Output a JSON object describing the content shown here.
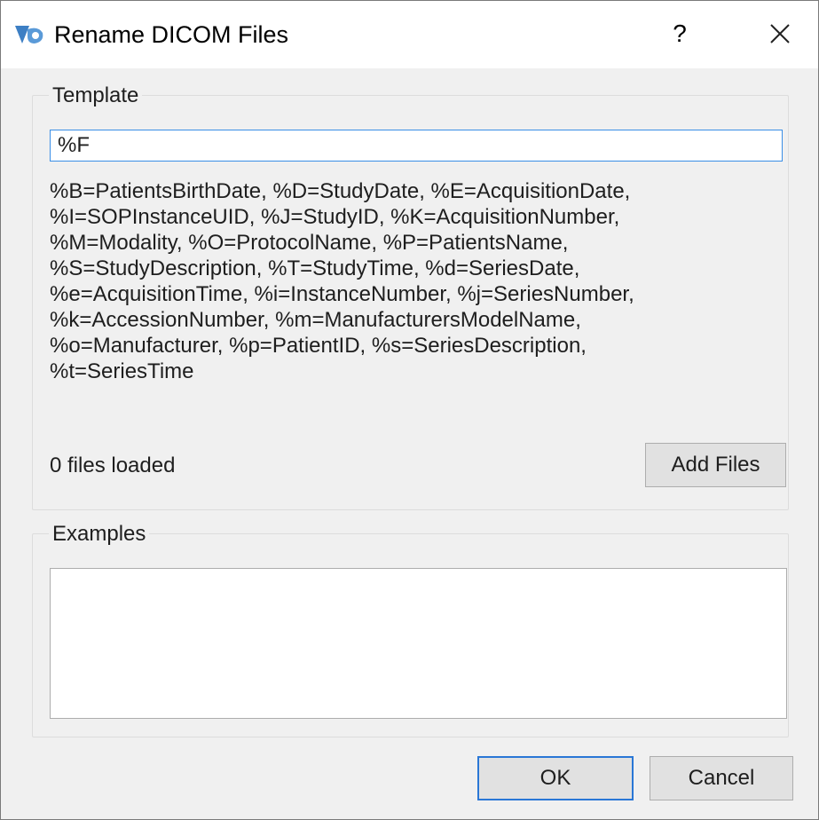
{
  "window": {
    "title": "Rename DICOM Files",
    "help_label": "?",
    "close_icon": "close-icon",
    "app_icon": "app-logo-icon"
  },
  "template_group": {
    "title": "Template",
    "input_value": "%F",
    "legend_lines": [
      "%B=PatientsBirthDate, %D=StudyDate, %E=AcquisitionDate,",
      "%I=SOPInstanceUID, %J=StudyID, %K=AcquisitionNumber,",
      "%M=Modality, %O=ProtocolName, %P=PatientsName,",
      "%S=StudyDescription, %T=StudyTime, %d=SeriesDate,",
      "%e=AcquisitionTime, %i=InstanceNumber, %j=SeriesNumber,",
      "%k=AccessionNumber, %m=ManufacturersModelName,",
      "%o=Manufacturer, %p=PatientID, %s=SeriesDescription,",
      "%t=SeriesTime"
    ],
    "files_status": "0 files loaded",
    "add_files_label": "Add Files"
  },
  "examples_group": {
    "title": "Examples",
    "content": ""
  },
  "buttons": {
    "ok_label": "OK",
    "cancel_label": "Cancel"
  },
  "colors": {
    "focus_accent": "#2a77d6",
    "logo_blue": "#3d7fc4",
    "dialog_bg": "#f0f0f0"
  }
}
